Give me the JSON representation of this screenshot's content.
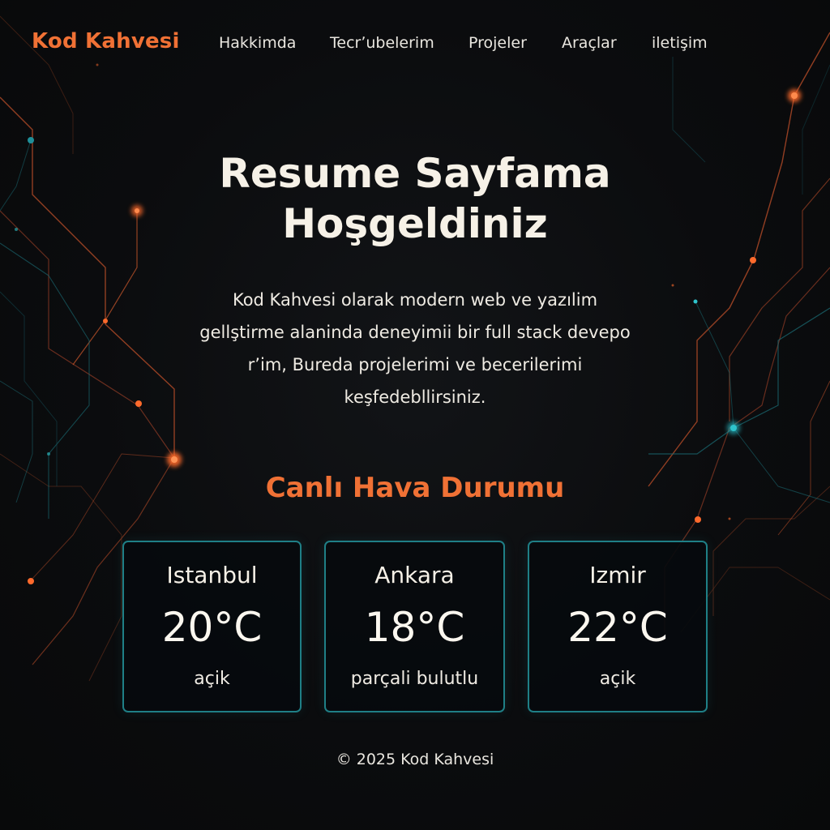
{
  "brand": {
    "name": "Kod Kahvesi"
  },
  "nav": {
    "items": [
      {
        "label": "Hakkimda"
      },
      {
        "label": "Tecrʼubelerim"
      },
      {
        "label": "Projeler"
      },
      {
        "label": "Araçlar"
      },
      {
        "label": "iletişim"
      }
    ]
  },
  "hero": {
    "title_line1": "Resume Sayfama",
    "title_line2": "Hoşgeldiniz",
    "desc_lines": [
      "Kod Kahvesi olarak modern web ve yazılim",
      "gellştirme alaninda deneyimii bir full stack devepo",
      "r’im, Bureda projelerimi ve becerilerimi",
      "keşfedebllirsiniz."
    ]
  },
  "weather": {
    "heading": "Canlı Hava Durumu",
    "cards": [
      {
        "city": "Istanbul",
        "temp": "20°C",
        "condition": "açik"
      },
      {
        "city": "Ankara",
        "temp": "18°C",
        "condition": "parçali bulutlu"
      },
      {
        "city": "Izmir",
        "temp": "22°C",
        "condition": "açik"
      }
    ]
  },
  "footer": {
    "copyright_symbol": "©",
    "text": "2025 Kod Kahvesi"
  },
  "colors": {
    "background": "#0a0b0d",
    "accent": "#f07135",
    "teal_border": "#1f7f86",
    "text": "#f3efe6"
  }
}
